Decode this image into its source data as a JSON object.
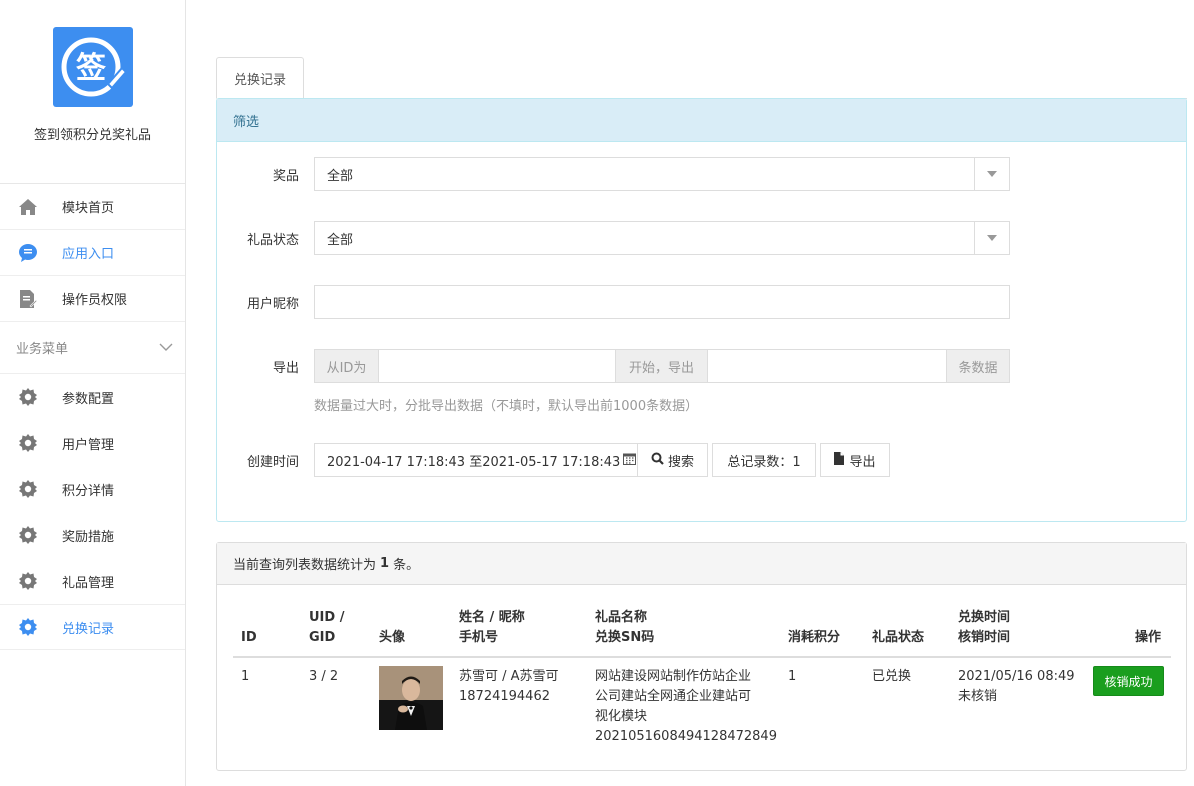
{
  "sidebar": {
    "app_name": "签到领积分兑奖礼品",
    "logo_glyph": "签",
    "top_items": [
      {
        "label": "模块首页",
        "icon": "home-icon"
      },
      {
        "label": "应用入口",
        "icon": "chat-icon"
      },
      {
        "label": "操作员权限",
        "icon": "document-edit-icon"
      }
    ],
    "group_title": "业务菜单",
    "sub_items": [
      {
        "label": "参数配置"
      },
      {
        "label": "用户管理"
      },
      {
        "label": "积分详情"
      },
      {
        "label": "奖励措施"
      },
      {
        "label": "礼品管理"
      },
      {
        "label": "兑换记录"
      }
    ],
    "accent_color": "#3d8ef0"
  },
  "tabs": [
    {
      "label": "兑换记录"
    }
  ],
  "filter": {
    "title": "筛选",
    "prize": {
      "label": "奖品",
      "value": "全部"
    },
    "gift_status": {
      "label": "礼品状态",
      "value": "全部"
    },
    "nickname": {
      "label": "用户昵称",
      "value": ""
    },
    "export": {
      "label": "导出",
      "prefix": "从ID为",
      "middle": "开始，导出",
      "suffix": "条数据",
      "help": "数据量过大时，分批导出数据（不填时，默认导出前1000条数据）"
    },
    "created": {
      "label": "创建时间",
      "range": "2021-04-17 17:18:43 至2021-05-17 17:18:43",
      "search_label": "搜索",
      "total_label": "总记录数：1",
      "export_label": "导出"
    }
  },
  "results": {
    "summary_prefix": "当前查询列表数据统计为",
    "summary_count": "1",
    "summary_suffix": "条。",
    "headers": {
      "id": "ID",
      "uid_line1": "UID /",
      "uid_line2": "GID",
      "avatar": "头像",
      "name_line1": "姓名 / 昵称",
      "name_line2": "手机号",
      "gift_line1": "礼品名称",
      "gift_line2": "兑换SN码",
      "points": "消耗积分",
      "status": "礼品状态",
      "time_line1": "兑换时间",
      "time_line2": "核销时间",
      "action": "操作"
    },
    "rows": [
      {
        "id": "1",
        "uid_gid": "3 / 2",
        "name": "苏雪可 / A苏雪可",
        "phone": "18724194462",
        "gift_line1": "网站建设网站制作仿站企业",
        "gift_line2": "公司建站全网通企业建站可",
        "gift_line3": "视化模块",
        "sn": "20210516084941284728​49",
        "points": "1",
        "status": "已兑换",
        "exchange_time": "2021/05/16 08:49",
        "verify_time": "未核销",
        "action_label": "核销成功"
      }
    ]
  }
}
